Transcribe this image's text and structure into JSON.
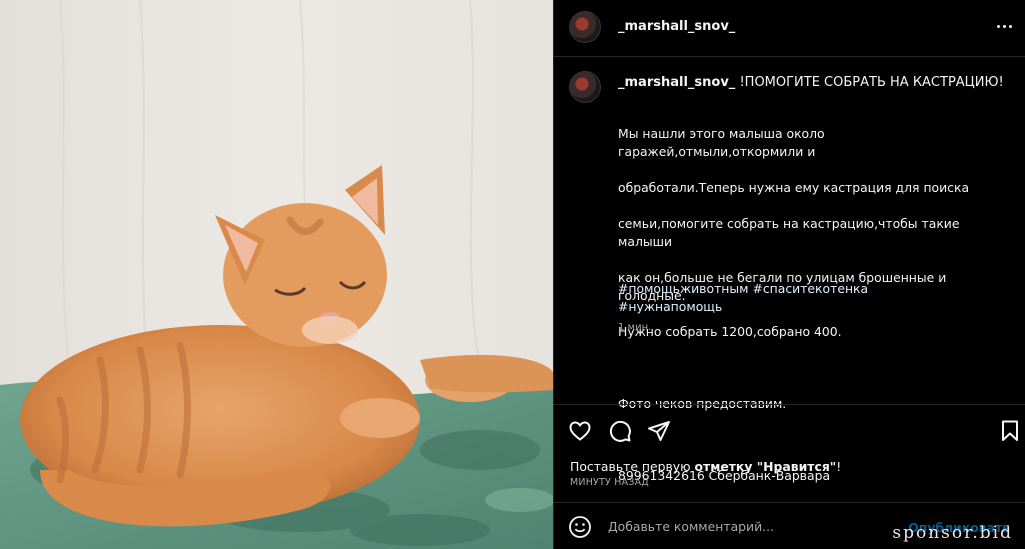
{
  "post": {
    "username": "_marshall_snov_",
    "caption_title": "!ПОМОГИТЕ СОБРАТЬ НА КАСТРАЦИЮ!",
    "caption_lines": [
      "Мы нашли этого малыша около гаражей,отмыли,откормили и",
      "обработали.Теперь нужна ему кастрация для поиска",
      "семьи,помогите собрать на кастрацию,чтобы такие малыши",
      "как он,больше не бегали по улицам брошенные и голодные.",
      "Нужно собрать 1200,собрано 400.",
      "",
      "Фото чеков предоставим.",
      "",
      "89961342616 Сбербанк-Варвара"
    ],
    "hashtags": [
      "#помощьживотным #спаситекотенка",
      "#нужнапомощь"
    ],
    "caption_time": "1 мин.",
    "likes_prefix": "Поставьте первую ",
    "likes_bold": "отметку \"Нравится\"",
    "likes_suffix": "!",
    "posted_ago": "МИНУТУ НАЗАД"
  },
  "comment_box": {
    "placeholder": "Добавьте комментарий...",
    "publish_label": "Опубликовать"
  },
  "icons": {
    "more": "more-options-icon",
    "like": "heart-icon",
    "comment": "comment-icon",
    "share": "send-icon",
    "save": "bookmark-icon",
    "emoji": "emoji-icon"
  },
  "watermark": "sponsor.bid",
  "colors": {
    "background": "#000000",
    "text": "#f5f5f5",
    "muted": "#a8a8a8",
    "link": "#e0f1ff",
    "publish": "#0b5a8e"
  }
}
